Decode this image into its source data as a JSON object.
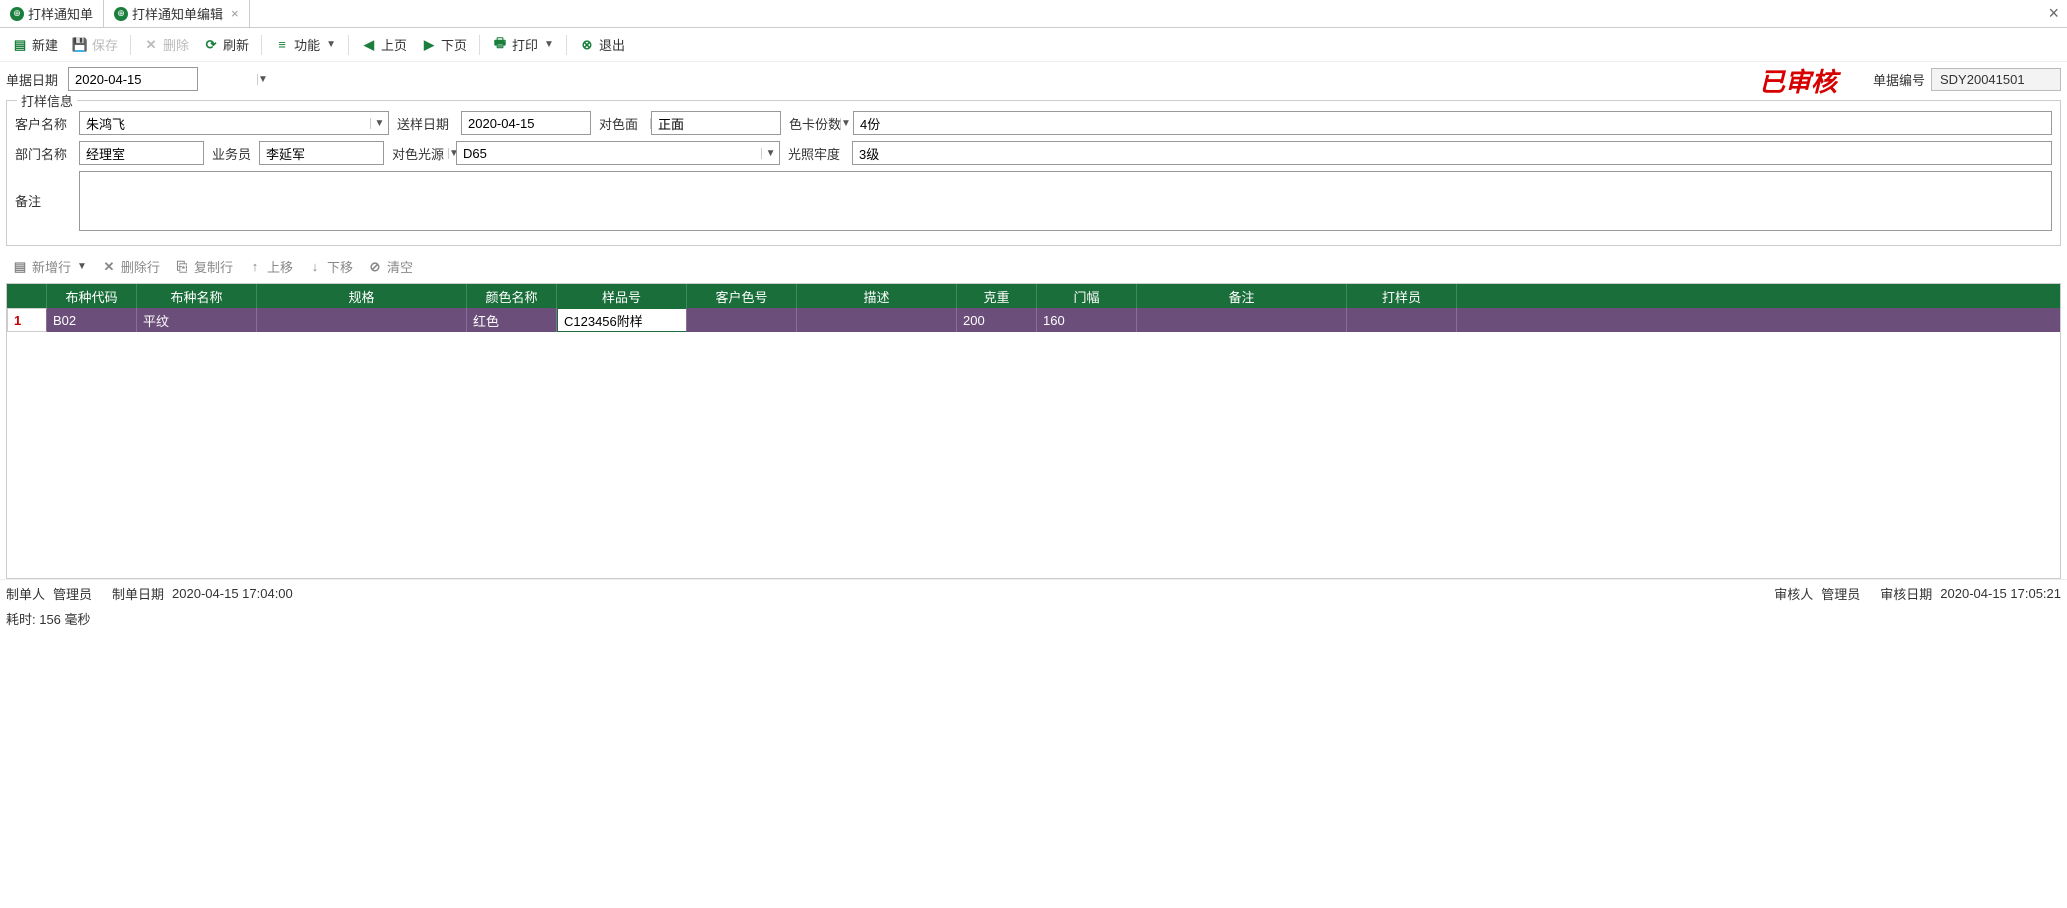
{
  "tabs": [
    {
      "label": "打样通知单"
    },
    {
      "label": "打样通知单编辑"
    }
  ],
  "toolbar": {
    "new": "新建",
    "save": "保存",
    "delete": "删除",
    "refresh": "刷新",
    "func": "功能",
    "prev": "上页",
    "next": "下页",
    "print": "打印",
    "exit": "退出"
  },
  "datebar": {
    "label": "单据日期",
    "value": "2020-04-15",
    "docno_label": "单据编号",
    "docno": "SDY20041501",
    "stamp": "已审核"
  },
  "group": {
    "title": "打样信息",
    "customer_label": "客户名称",
    "customer": "朱鸿飞",
    "send_date_label": "送样日期",
    "send_date": "2020-04-15",
    "compare_side_label": "对色面",
    "compare_side": "正面",
    "card_count_label": "色卡份数",
    "card_count": "4份",
    "dept_label": "部门名称",
    "dept": "经理室",
    "sales_label": "业务员",
    "sales": "李延军",
    "light_source_label": "对色光源",
    "light_source": "D65",
    "light_fastness_label": "光照牢度",
    "light_fastness": "3级",
    "remark_label": "备注",
    "remark": ""
  },
  "gridbar": {
    "addrow": "新增行",
    "delrow": "删除行",
    "copyrow": "复制行",
    "moveup": "上移",
    "movedown": "下移",
    "clear": "清空"
  },
  "grid": {
    "headers": [
      "布种代码",
      "布种名称",
      "规格",
      "颜色名称",
      "样品号",
      "客户色号",
      "描述",
      "克重",
      "门幅",
      "备注",
      "打样员"
    ],
    "rows": [
      {
        "num": "1",
        "code": "B02",
        "name": "平纹",
        "spec": "",
        "color": "红色",
        "sample": "C123456附样",
        "cust_color": "",
        "desc": "",
        "weight": "200",
        "width": "160",
        "remark": "",
        "staff": ""
      }
    ]
  },
  "footer": {
    "creator_label": "制单人",
    "creator": "管理员",
    "create_date_label": "制单日期",
    "create_date": "2020-04-15 17:04:00",
    "auditor_label": "审核人",
    "auditor": "管理员",
    "audit_date_label": "审核日期",
    "audit_date": "2020-04-15 17:05:21"
  },
  "status": "耗时: 156 毫秒"
}
